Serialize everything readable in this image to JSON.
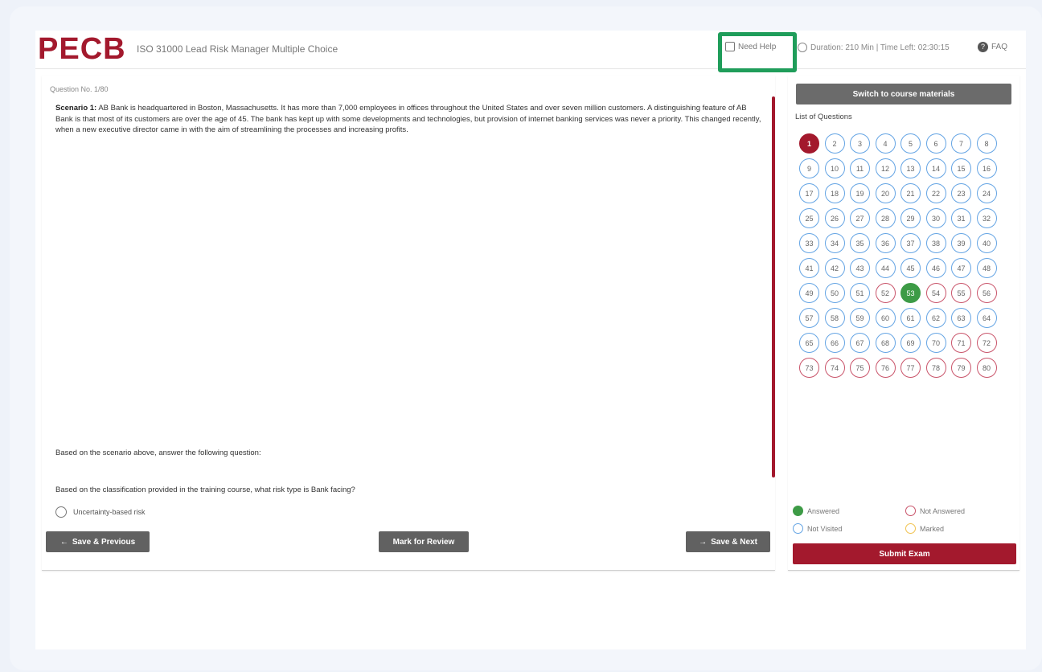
{
  "header": {
    "logo": "PECB",
    "exam_title": "ISO 31000 Lead Risk Manager Multiple Choice",
    "need_help": "Need Help",
    "timer": "Duration: 210 Min | Time Left: 02:30:15",
    "faq": "FAQ"
  },
  "question": {
    "number": "Question No. 1/80",
    "scenario_label": "Scenario 1:",
    "scenario_text": "AB Bank is headquartered in Boston, Massachusetts. It has more than 7,000 employees in offices throughout the United States and over seven million customers. A distinguishing feature of AB Bank is that most of its customers are over the age of 45. The bank has kept up with some developments and technologies, but provision of internet banking services was never a priority. This changed recently, when a new executive director came in with the aim of streamlining the processes and increasing profits.",
    "prompt1": "Based on the scenario above, answer the following question:",
    "prompt2": "Based on the classification provided in the training course, what risk type is      Bank facing?",
    "option1": "Uncertainty-based risk"
  },
  "buttons": {
    "prev": "Save & Previous",
    "review": "Mark for Review",
    "next": "Save & Next",
    "switch": "Switch to course materials",
    "submit": "Submit Exam"
  },
  "sidebar": {
    "list_title": "List of Questions",
    "questions": [
      {
        "n": "1",
        "s": "cur"
      },
      {
        "n": "2",
        "s": "nv"
      },
      {
        "n": "3",
        "s": "nv"
      },
      {
        "n": "4",
        "s": "nv"
      },
      {
        "n": "5",
        "s": "nv"
      },
      {
        "n": "6",
        "s": "nv"
      },
      {
        "n": "7",
        "s": "nv"
      },
      {
        "n": "8",
        "s": "nv"
      },
      {
        "n": "9",
        "s": "nv"
      },
      {
        "n": "10",
        "s": "nv"
      },
      {
        "n": "11",
        "s": "nv"
      },
      {
        "n": "12",
        "s": "nv"
      },
      {
        "n": "13",
        "s": "nv"
      },
      {
        "n": "14",
        "s": "nv"
      },
      {
        "n": "15",
        "s": "nv"
      },
      {
        "n": "16",
        "s": "nv"
      },
      {
        "n": "17",
        "s": "nv"
      },
      {
        "n": "18",
        "s": "nv"
      },
      {
        "n": "19",
        "s": "nv"
      },
      {
        "n": "20",
        "s": "nv"
      },
      {
        "n": "21",
        "s": "nv"
      },
      {
        "n": "22",
        "s": "nv"
      },
      {
        "n": "23",
        "s": "nv"
      },
      {
        "n": "24",
        "s": "nv"
      },
      {
        "n": "25",
        "s": "nv"
      },
      {
        "n": "26",
        "s": "nv"
      },
      {
        "n": "27",
        "s": "nv"
      },
      {
        "n": "28",
        "s": "nv"
      },
      {
        "n": "29",
        "s": "nv"
      },
      {
        "n": "30",
        "s": "nv"
      },
      {
        "n": "31",
        "s": "nv"
      },
      {
        "n": "32",
        "s": "nv"
      },
      {
        "n": "33",
        "s": "nv"
      },
      {
        "n": "34",
        "s": "nv"
      },
      {
        "n": "35",
        "s": "nv"
      },
      {
        "n": "36",
        "s": "nv"
      },
      {
        "n": "37",
        "s": "nv"
      },
      {
        "n": "38",
        "s": "nv"
      },
      {
        "n": "39",
        "s": "nv"
      },
      {
        "n": "40",
        "s": "nv"
      },
      {
        "n": "41",
        "s": "nv"
      },
      {
        "n": "42",
        "s": "nv"
      },
      {
        "n": "43",
        "s": "nv"
      },
      {
        "n": "44",
        "s": "nv"
      },
      {
        "n": "45",
        "s": "nv"
      },
      {
        "n": "46",
        "s": "nv"
      },
      {
        "n": "47",
        "s": "nv"
      },
      {
        "n": "48",
        "s": "nv"
      },
      {
        "n": "49",
        "s": "nv"
      },
      {
        "n": "50",
        "s": "nv"
      },
      {
        "n": "51",
        "s": "nv"
      },
      {
        "n": "52",
        "s": "na"
      },
      {
        "n": "53",
        "s": "ans"
      },
      {
        "n": "54",
        "s": "na"
      },
      {
        "n": "55",
        "s": "na"
      },
      {
        "n": "56",
        "s": "na"
      },
      {
        "n": "57",
        "s": "nv"
      },
      {
        "n": "58",
        "s": "nv"
      },
      {
        "n": "59",
        "s": "nv"
      },
      {
        "n": "60",
        "s": "nv"
      },
      {
        "n": "61",
        "s": "nv"
      },
      {
        "n": "62",
        "s": "nv"
      },
      {
        "n": "63",
        "s": "nv"
      },
      {
        "n": "64",
        "s": "nv"
      },
      {
        "n": "65",
        "s": "nv"
      },
      {
        "n": "66",
        "s": "nv"
      },
      {
        "n": "67",
        "s": "nv"
      },
      {
        "n": "68",
        "s": "nv"
      },
      {
        "n": "69",
        "s": "nv"
      },
      {
        "n": "70",
        "s": "nv"
      },
      {
        "n": "71",
        "s": "na"
      },
      {
        "n": "72",
        "s": "na"
      },
      {
        "n": "73",
        "s": "na"
      },
      {
        "n": "74",
        "s": "na"
      },
      {
        "n": "75",
        "s": "na"
      },
      {
        "n": "76",
        "s": "na"
      },
      {
        "n": "77",
        "s": "na"
      },
      {
        "n": "78",
        "s": "na"
      },
      {
        "n": "79",
        "s": "na"
      },
      {
        "n": "80",
        "s": "na"
      }
    ]
  },
  "legend": {
    "answered": "Answered",
    "not_answered": "Not Answered",
    "not_visited": "Not Visited",
    "marked": "Marked"
  },
  "colors": {
    "brand": "#a3192d",
    "answered": "#3d9b46",
    "not_visited": "#64a4e4",
    "not_answered": "#c9546a",
    "marked": "#f0c24f",
    "highlight": "#1f9d5a"
  }
}
